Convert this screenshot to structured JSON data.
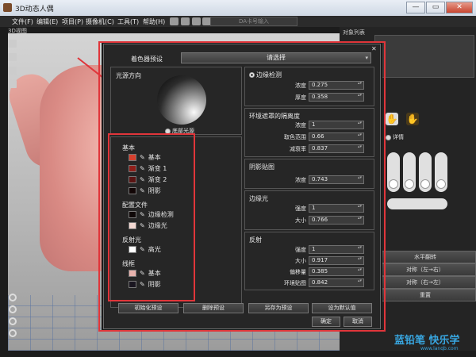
{
  "window": {
    "title": "3D动态人偶",
    "buttons": {
      "minimize": "—",
      "maximize": "▭",
      "close": "✕"
    }
  },
  "menubar": {
    "items": [
      "文件(F)",
      "编辑(E)",
      "项目(P)",
      "摄像机(C)",
      "工具(T)",
      "帮助(H)"
    ],
    "da_box": "DA卡号输入"
  },
  "viewport": {
    "label": "3D视图"
  },
  "rightpanel": {
    "label": "对象列表",
    "detail_label": "详情",
    "flip_button": "水平翻转",
    "sym_lr": "对称（左→右）",
    "sym_rl": "对称（右→左）",
    "reset": "重置"
  },
  "dialog": {
    "close": "✕",
    "preset_label": "着色器预设",
    "preset_value": "请选择",
    "light_direction": "光源方向",
    "bottom_light": "底部光源",
    "groups": [
      {
        "title": "基本",
        "rows": [
          {
            "label": "基本",
            "color": "#d6402e"
          },
          {
            "label": "渐变 1",
            "color": "#8e1f1a"
          },
          {
            "label": "渐变 2",
            "color": "#5a1413"
          },
          {
            "label": "阴影",
            "color": "#120606"
          }
        ]
      },
      {
        "title": "配置文件",
        "rows": [
          {
            "label": "边缘检测",
            "color": "#0f0808"
          },
          {
            "label": "边缘光",
            "color": "#f3d8d2"
          }
        ]
      },
      {
        "title": "反射光",
        "rows": [
          {
            "label": "高光",
            "color": "#ffffff"
          }
        ]
      },
      {
        "title": "线框",
        "rows": [
          {
            "label": "基本",
            "color": "#e7b2ad"
          },
          {
            "label": "阴影",
            "color": "#1a1620"
          }
        ]
      }
    ],
    "edge": {
      "title": "边缘检测",
      "rows": [
        {
          "label": "浓度",
          "value": "0.275"
        },
        {
          "label": "厚度",
          "value": "0.358"
        }
      ]
    },
    "ao": {
      "title": "环境遮罩的隔离度",
      "rows": [
        {
          "label": "浓度",
          "value": "1"
        },
        {
          "label": "取色范围",
          "value": "0.66"
        },
        {
          "label": "减衰率",
          "value": "0.837"
        }
      ]
    },
    "shadow_map": {
      "title": "阴影贴图",
      "rows": [
        {
          "label": "浓度",
          "value": "0.743"
        }
      ]
    },
    "rim": {
      "title": "边缘光",
      "rows": [
        {
          "label": "强度",
          "value": "1"
        },
        {
          "label": "大小",
          "value": "0.766"
        }
      ]
    },
    "reflect": {
      "title": "反射",
      "rows": [
        {
          "label": "强度",
          "value": "1"
        },
        {
          "label": "大小",
          "value": "0.917"
        },
        {
          "label": "偏移量",
          "value": "0.385"
        },
        {
          "label": "环境贴图",
          "value": "0.842"
        }
      ]
    },
    "footer": {
      "init": "初始化预设",
      "delete": "删除预设",
      "save_as": "另存为预设",
      "set_default": "设为默认值",
      "ok": "确定",
      "cancel": "取消"
    }
  },
  "watermark": {
    "text": "蓝铅笔 快乐学",
    "url": "www.lanqb.com"
  },
  "accent_color": "#e0353a"
}
